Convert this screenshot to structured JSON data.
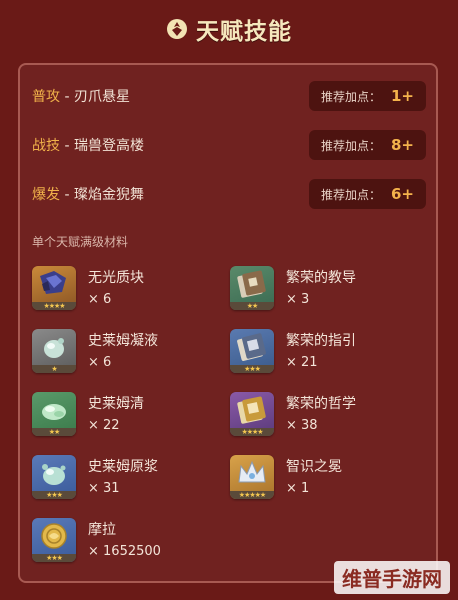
{
  "header": {
    "title": "天赋技能",
    "icon": "talent-icon"
  },
  "skills": [
    {
      "type": "普攻",
      "sep": " - ",
      "name": "刃爪悬星",
      "rec_label": "推荐加点：",
      "rec_value": "1+"
    },
    {
      "type": "战技",
      "sep": " - ",
      "name": "瑞兽登高楼",
      "rec_label": "推荐加点：",
      "rec_value": "8+"
    },
    {
      "type": "爆发",
      "sep": " - ",
      "name": "璨焰金猊舞",
      "rec_label": "推荐加点：",
      "rec_value": "6+"
    }
  ],
  "materials_heading": "单个天赋满级材料",
  "materials": [
    {
      "name": "无光质块",
      "count": "× 6",
      "icon": "dark-crystal-icon",
      "stars": "★★★★"
    },
    {
      "name": "繁荣的教导",
      "count": "× 3",
      "icon": "book-teachings-icon",
      "stars": "★★"
    },
    {
      "name": "史莱姆凝液",
      "count": "× 6",
      "icon": "slime-condensate-icon",
      "stars": "★"
    },
    {
      "name": "繁荣的指引",
      "count": "× 21",
      "icon": "book-guide-icon",
      "stars": "★★★"
    },
    {
      "name": "史莱姆清",
      "count": "× 22",
      "icon": "slime-secretions-icon",
      "stars": "★★"
    },
    {
      "name": "繁荣的哲学",
      "count": "× 38",
      "icon": "book-philosophies-icon",
      "stars": "★★★★"
    },
    {
      "name": "史莱姆原浆",
      "count": "× 31",
      "icon": "slime-concentrate-icon",
      "stars": "★★★"
    },
    {
      "name": "智识之冕",
      "count": "× 1",
      "icon": "crown-icon",
      "stars": "★★★★★"
    },
    {
      "name": "摩拉",
      "count": "× 1652500",
      "icon": "mora-coin-icon",
      "stars": "★★★"
    }
  ],
  "watermark": "维普手游网"
}
